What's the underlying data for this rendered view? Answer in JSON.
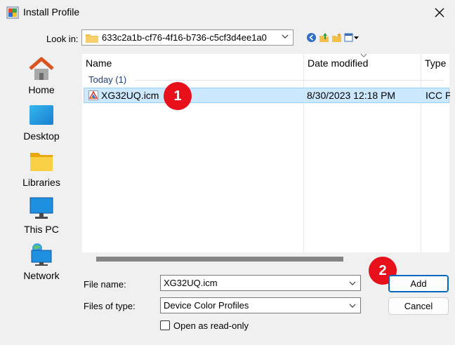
{
  "window": {
    "title": "Install Profile"
  },
  "lookin": {
    "label": "Look in:",
    "value": "633c2a1b-cf76-4f16-b736-c5cf3d4ee1a0"
  },
  "places": [
    {
      "label": "Home",
      "icon": "home-icon"
    },
    {
      "label": "Desktop",
      "icon": "desktop-icon"
    },
    {
      "label": "Libraries",
      "icon": "libraries-icon"
    },
    {
      "label": "This PC",
      "icon": "this-pc-icon"
    },
    {
      "label": "Network",
      "icon": "network-icon"
    }
  ],
  "filelist": {
    "columns": [
      "Name",
      "Date modified",
      "Type"
    ],
    "group": "Today (1)",
    "rows": [
      {
        "name": "XG32UQ.icm",
        "date": "8/30/2023 12:18 PM",
        "type": "ICC Pro"
      }
    ]
  },
  "form": {
    "filename_label": "File name:",
    "filename_value": "XG32UQ.icm",
    "filetype_label": "Files of type:",
    "filetype_value": "Device Color Profiles",
    "readonly_label": "Open as read-only"
  },
  "buttons": {
    "add": "Add",
    "cancel": "Cancel"
  },
  "badges": {
    "one": "1",
    "two": "2"
  },
  "colors": {
    "selection": "#cce8ff",
    "badge": "#e8101a",
    "accent": "#0067c0"
  }
}
